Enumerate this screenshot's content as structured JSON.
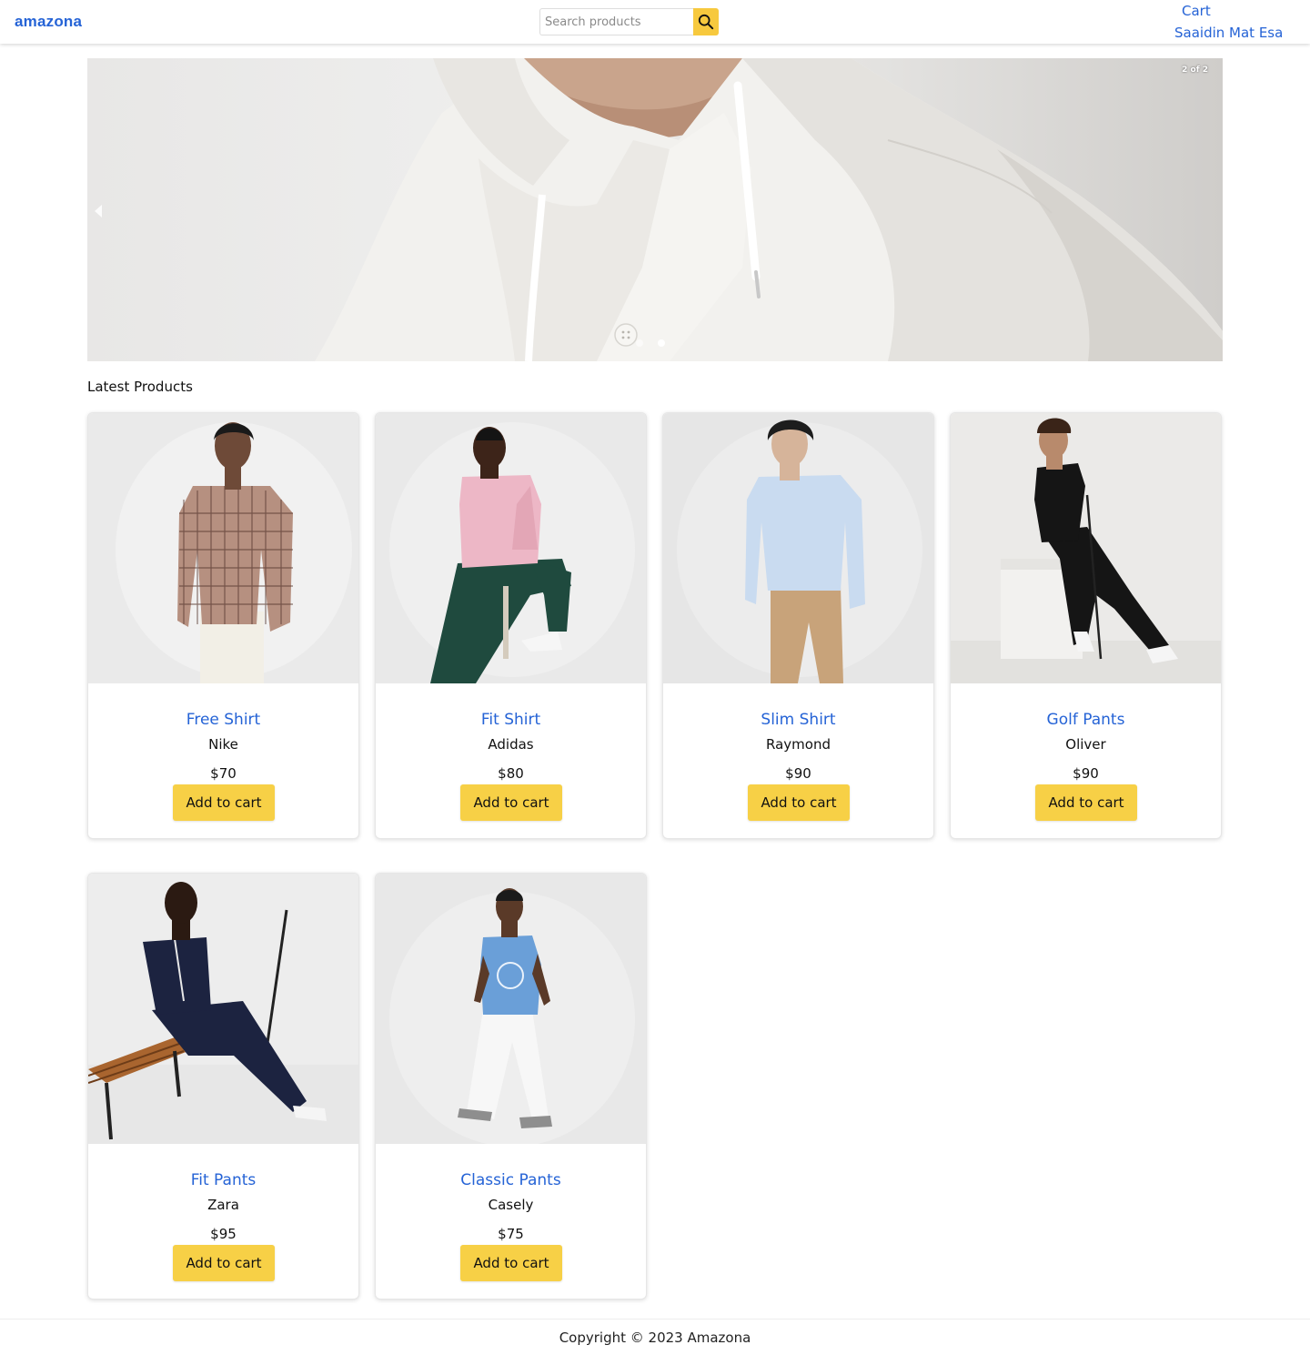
{
  "header": {
    "brand": "amazona",
    "search": {
      "placeholder": "Search products",
      "value": ""
    },
    "search_icon": "search-icon",
    "nav": {
      "cart": "Cart",
      "user": "Saaidin Mat Esa"
    }
  },
  "carousel": {
    "counter": "2 of 2",
    "prev_icon": "chevron-left-icon",
    "slides": 2,
    "active_slide": 2
  },
  "section": {
    "title": "Latest Products"
  },
  "products": [
    {
      "name": "Free Shirt",
      "brand": "Nike",
      "price": "$70",
      "button": "Add to cart"
    },
    {
      "name": "Fit Shirt",
      "brand": "Adidas",
      "price": "$80",
      "button": "Add to cart"
    },
    {
      "name": "Slim Shirt",
      "brand": "Raymond",
      "price": "$90",
      "button": "Add to cart"
    },
    {
      "name": "Golf Pants",
      "brand": "Oliver",
      "price": "$90",
      "button": "Add to cart"
    },
    {
      "name": "Fit Pants",
      "brand": "Zara",
      "price": "$95",
      "button": "Add to cart"
    },
    {
      "name": "Classic Pants",
      "brand": "Casely",
      "price": "$75",
      "button": "Add to cart"
    }
  ],
  "footer": {
    "text": "Copyright © 2023 Amazona"
  },
  "colors": {
    "link": "#2563d6",
    "button": "#f7d046",
    "search_button": "#f7c93e"
  }
}
